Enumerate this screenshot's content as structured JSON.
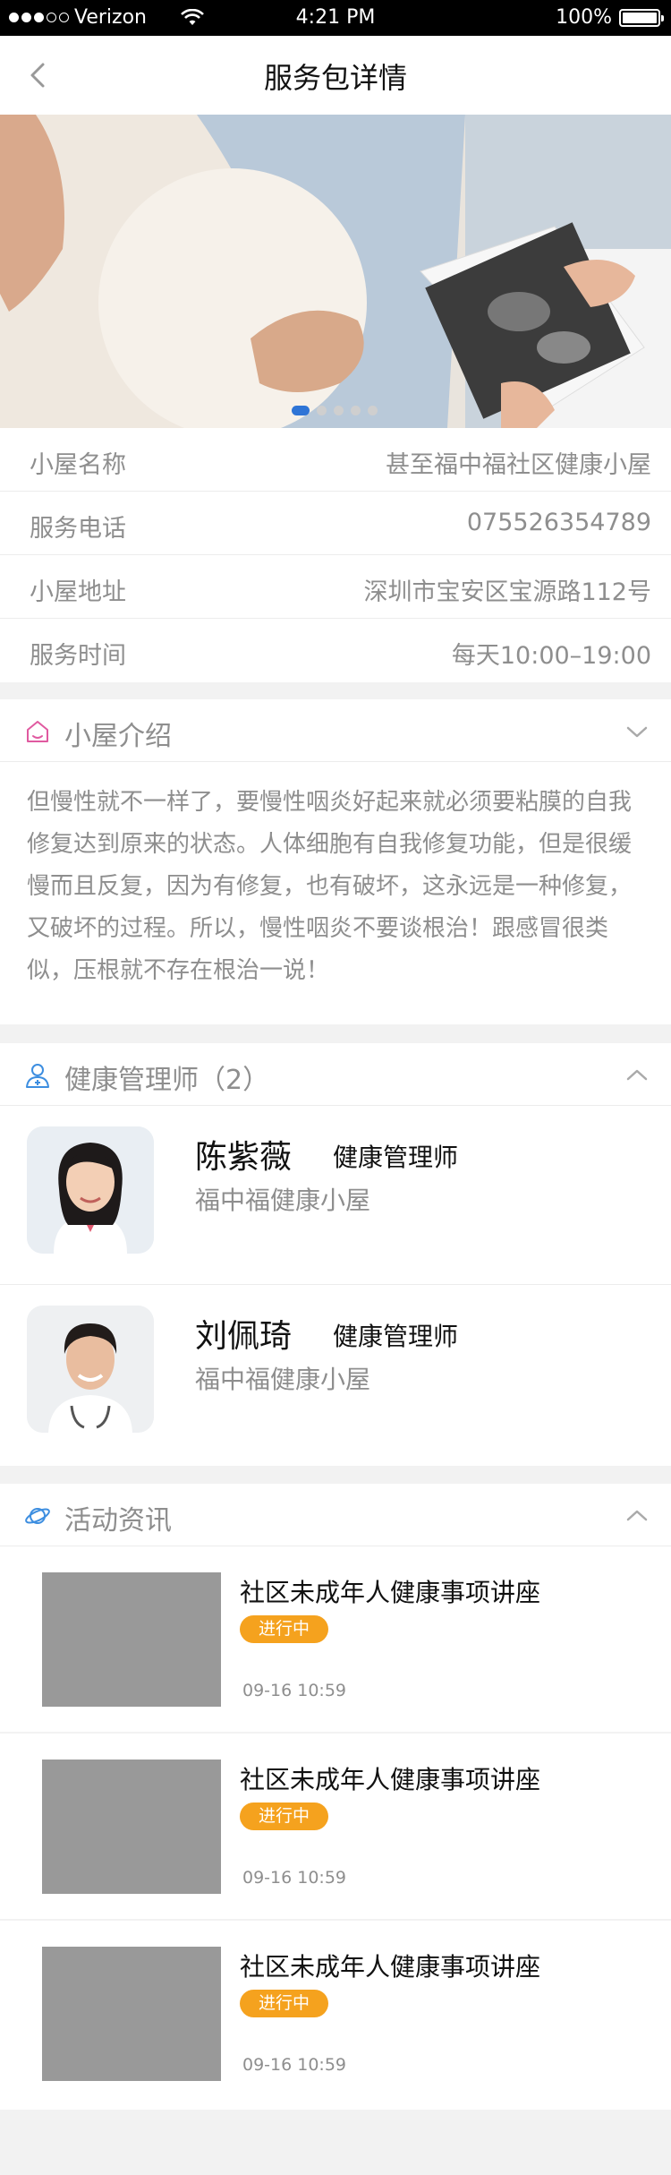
{
  "status_bar": {
    "carrier": "Verizon",
    "time": "4:21 PM",
    "battery": "100%"
  },
  "nav": {
    "title": "服务包详情",
    "back_icon": "chevron-left-icon"
  },
  "banner": {
    "page_count": 5,
    "active_page": 1
  },
  "info": {
    "rows": [
      {
        "label": "小屋名称",
        "value": "甚至福中福社区健康小屋"
      },
      {
        "label": "服务电话",
        "value": "075526354789"
      },
      {
        "label": "小屋地址",
        "value": "深圳市宝安区宝源路112号"
      },
      {
        "label": "服务时间",
        "value": "每天10:00–19:00"
      }
    ]
  },
  "intro": {
    "title": "小屋介绍",
    "icon": "house-icon",
    "text": "但慢性就不一样了，要慢性咽炎好起来就必须要粘膜的自我修复达到原来的状态。人体细胞有自我修复功能，但是很缓慢而且反复，因为有修复，也有破坏，这永远是一种修复，又破坏的过程。所以，慢性咽炎不要谈根治！跟感冒很类似，压根就不存在根治一说！"
  },
  "managers": {
    "title": "健康管理师（2）",
    "icon": "doctor-icon",
    "items": [
      {
        "name": "陈紫薇",
        "role": "健康管理师",
        "place": "福中福健康小屋"
      },
      {
        "name": "刘佩琦",
        "role": "健康管理师",
        "place": "福中福健康小屋"
      }
    ]
  },
  "news": {
    "title": "活动资讯",
    "icon": "planet-icon",
    "items": [
      {
        "title": "社区未成年人健康事项讲座",
        "status": "进行中",
        "time": "09-16  10:59"
      },
      {
        "title": "社区未成年人健康事项讲座",
        "status": "进行中",
        "time": "09-16  10:59"
      },
      {
        "title": "社区未成年人健康事项讲座",
        "status": "进行中",
        "time": "09-16  10:59"
      }
    ]
  },
  "colors": {
    "accent": "#2e74d6",
    "badge": "#f5a21e",
    "house_icon": "#e05aa0",
    "icon_blue": "#3d8ee0"
  }
}
